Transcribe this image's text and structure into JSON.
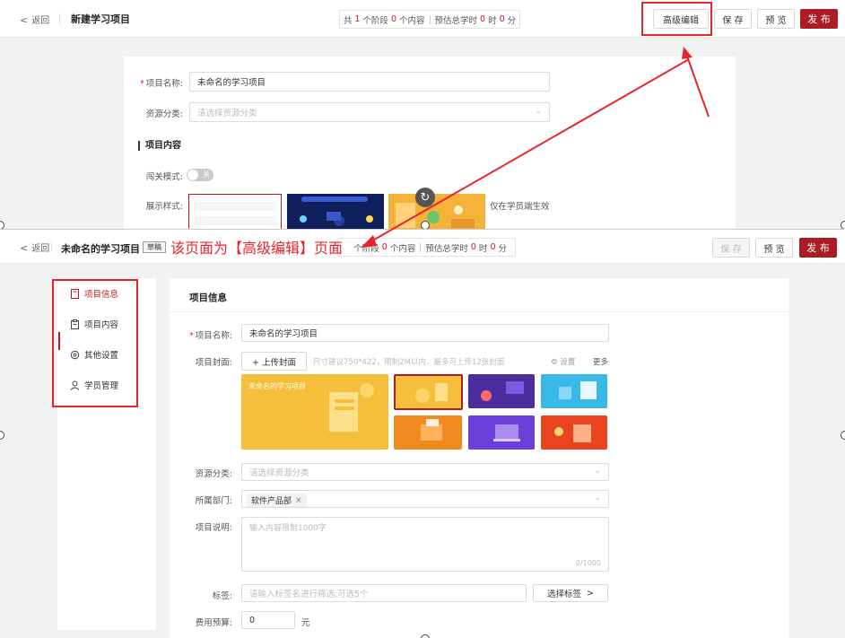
{
  "top": {
    "back_label": "返回",
    "title": "新建学习项目",
    "summary": {
      "prefix": "共",
      "stages": "1",
      "stages_unit": "个阶段",
      "contents": "0",
      "contents_unit": "个内容",
      "hours_label": "预估总学时",
      "hours": "0",
      "hours_unit": "时",
      "minutes": "0",
      "minutes_unit": "分"
    },
    "buttons": {
      "advanced": "高级编辑",
      "save": "保 存",
      "preview": "预 览",
      "publish": "发 布"
    },
    "form": {
      "name_label": "项目名称:",
      "name_value": "未命名的学习项目",
      "category_label": "资源分类:",
      "category_placeholder": "请选择资源分类",
      "section_title": "项目内容",
      "gate_label": "闯关模式:",
      "gate_toggle": "关",
      "style_label": "展示样式:",
      "style_note": "仅在学员端生效"
    }
  },
  "bottom": {
    "back_label": "返回",
    "title": "未命名的学习项目",
    "draft_badge": "草稿",
    "annotation": "该页面为【高级编辑】页面",
    "summary": {
      "stages_unit": "个阶段",
      "contents": "0",
      "contents_unit": "个内容",
      "hours_label": "预估总学时",
      "hours": "0",
      "hours_unit": "时",
      "minutes": "0",
      "minutes_unit": "分"
    },
    "buttons": {
      "save": "保 存",
      "preview": "预 览",
      "publish": "发 布"
    },
    "sidebar": [
      {
        "label": "项目信息",
        "icon": "document-icon",
        "active": true
      },
      {
        "label": "项目内容",
        "icon": "clipboard-icon",
        "active": false
      },
      {
        "label": "其他设置",
        "icon": "gear-icon",
        "active": false
      },
      {
        "label": "学员管理",
        "icon": "user-icon",
        "active": false
      }
    ],
    "main": {
      "section_title": "项目信息",
      "name_label": "项目名称:",
      "name_value": "未命名的学习项目",
      "cover_label": "项目封面:",
      "upload_label": "+ 上传封面",
      "upload_hint": "尺寸建议750*422，限制2M以内，最多可上传12张封面",
      "settings_label": "设置",
      "more_label": "更多",
      "cover_title": "未命名的学习项目",
      "category_label": "资源分类:",
      "category_placeholder": "请选择资源分类",
      "dept_label": "所属部门:",
      "dept_value": "软件产品部",
      "desc_label": "项目说明:",
      "desc_placeholder": "输入内容限制1000字",
      "desc_counter": "0/1000",
      "tag_label": "标签:",
      "tag_placeholder": "请输入标签名进行筛选,可选5个",
      "tag_button": "选择标签",
      "budget_label": "费用预算:",
      "budget_value": "0",
      "budget_unit": "元"
    }
  },
  "colors": {
    "accent": "#ae1c23",
    "highlight": "#e8242b"
  }
}
